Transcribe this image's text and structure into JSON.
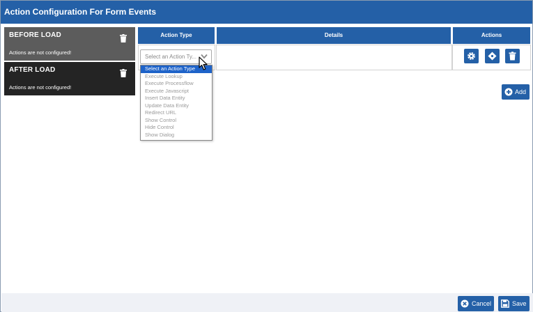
{
  "dialog": {
    "title": "Action Configuration For Form Events"
  },
  "events": [
    {
      "title": "BEFORE LOAD",
      "status": "Actions are not configured!"
    },
    {
      "title": "AFTER LOAD",
      "status": "Actions are not configured!"
    }
  ],
  "table": {
    "headers": {
      "action_type": "Action Type",
      "details": "Details",
      "actions": "Actions"
    }
  },
  "action_select": {
    "value": "Select an Action Ty...",
    "options": [
      "Select an Action Type",
      "Execute Lookup",
      "Execute Processflow",
      "Execute Javascript",
      "Insert Data Entity",
      "Update Data Entity",
      "Redirect URL",
      "Show Control",
      "Hide Control",
      "Show Dialog"
    ],
    "selected_index": 0
  },
  "add_button": {
    "label": "Add"
  },
  "footer": {
    "cancel_label": "Cancel",
    "save_label": "Save"
  },
  "colors": {
    "primary": "#2460a7",
    "before_load_bg": "#5c5c5c",
    "after_load_bg": "#242424",
    "option_selected": "#1e63c9"
  }
}
